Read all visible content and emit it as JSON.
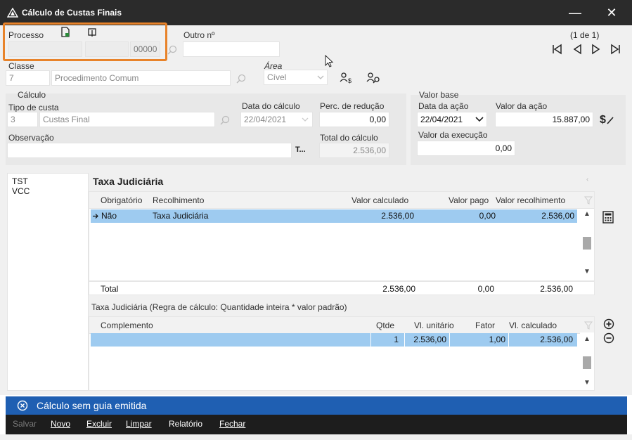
{
  "window": {
    "title": "Cálculo de Custas Finais",
    "minimize": "—",
    "close": "✕"
  },
  "processo": {
    "label": "Processo",
    "seg1": "",
    "seg2": "",
    "seg3": "00000"
  },
  "outro": {
    "label": "Outro nº",
    "value": ""
  },
  "pager": {
    "text": "(1 de 1)"
  },
  "classe": {
    "label": "Classe",
    "code": "7",
    "name": "Procedimento Comum"
  },
  "area": {
    "label": "Área",
    "value": "Cível"
  },
  "calculo": {
    "group_label": "Cálculo",
    "tipo_label": "Tipo de custa",
    "tipo_code": "3",
    "tipo_name": "Custas Final",
    "data_label": "Data do cálculo",
    "data_value": "22/04/2021",
    "perc_label": "Perc. de redução",
    "perc_value": "0,00",
    "obs_label": "Observação",
    "obs_value": "",
    "obs_btn": "T...",
    "total_label": "Total do cálculo",
    "total_value": "2.536,00"
  },
  "valor_base": {
    "group_label": "Valor base",
    "data_acao_label": "Data da ação",
    "data_acao_value": "22/04/2021",
    "valor_acao_label": "Valor da ação",
    "valor_acao_value": "15.887,00",
    "valor_exec_label": "Valor da execução",
    "valor_exec_value": "0,00"
  },
  "left_list": [
    "TST",
    "VCC"
  ],
  "taxa": {
    "title": "Taxa Judiciária",
    "columns": [
      "Obrigatório",
      "Recolhimento",
      "Valor calculado",
      "Valor pago",
      "Valor recolhimento"
    ],
    "rows": [
      {
        "obrigatorio": "Não",
        "recolhimento": "Taxa Judiciária",
        "calculado": "2.536,00",
        "pago": "0,00",
        "recolhido": "2.536,00"
      }
    ],
    "total_label": "Total",
    "total_calculado": "2.536,00",
    "total_pago": "0,00",
    "total_recolhido": "2.536,00"
  },
  "regra": {
    "text": "Taxa Judiciária (Regra de cálculo: Quantidade inteira * valor padrão)"
  },
  "complemento": {
    "columns": [
      "Complemento",
      "Qtde",
      "Vl. unitário",
      "Fator",
      "Vl. calculado"
    ],
    "rows": [
      {
        "complemento": "",
        "qtde": "1",
        "unitario": "2.536,00",
        "fator": "1,00",
        "calculado": "2.536,00"
      }
    ]
  },
  "status": {
    "text": "Cálculo sem guia emitida"
  },
  "toolbar": {
    "salvar": "Salvar",
    "novo": "Novo",
    "excluir": "Excluir",
    "limpar": "Limpar",
    "relatorio": "Relatório",
    "fechar": "Fechar"
  },
  "colors": {
    "accent": "#1f5fb2",
    "selection": "#9ecbf0",
    "highlight": "#e8832a",
    "titlebar": "#2b2b2b",
    "toolbar": "#1d1d1d"
  }
}
